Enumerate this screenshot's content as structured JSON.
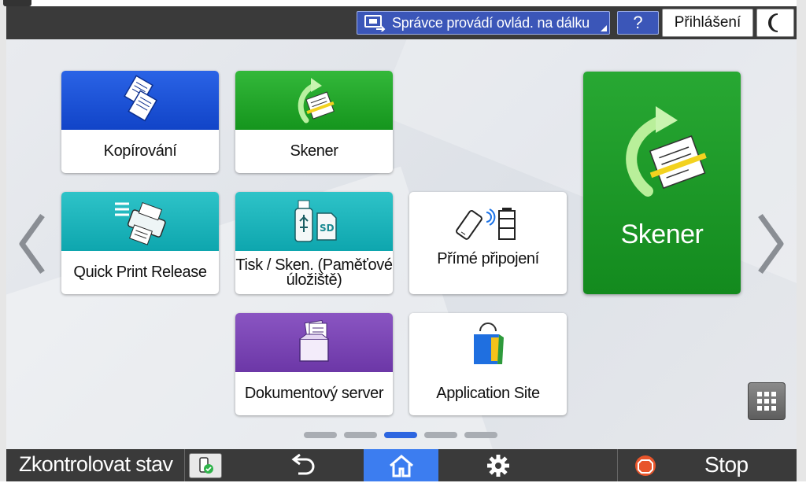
{
  "topbar": {
    "remote_label": "Správce provádí ovlád. na dálku",
    "help_label": "?",
    "login_label": "Přihlášení"
  },
  "tiles": [
    {
      "label": "Kopírování",
      "icon": "copy-icon"
    },
    {
      "label": "Skener",
      "icon": "scanner-icon"
    },
    {
      "label": "Quick Print Release",
      "icon": "quick-print-icon"
    },
    {
      "label": "Tisk / Sken. (Paměťové úložiště)",
      "icon": "usb-sd-icon"
    },
    {
      "label": "Přímé připojení",
      "icon": "direct-connection-icon"
    },
    {
      "label": "Dokumentový server",
      "icon": "document-server-icon"
    },
    {
      "label": "Application Site",
      "icon": "shopping-bag-icon"
    }
  ],
  "featured": {
    "label": "Skener",
    "icon": "scanner-icon"
  },
  "pager": {
    "pages": 5,
    "active": 3
  },
  "bottombar": {
    "status_label": "Zkontrolovat stav",
    "stop_label": "Stop"
  },
  "colors": {
    "bar": "#3a3a3a",
    "accent": "#3c7df0",
    "copy": "#1e55d8",
    "scan": "#22a12a",
    "teal": "#1db5bc",
    "purple": "#7a45b5"
  }
}
